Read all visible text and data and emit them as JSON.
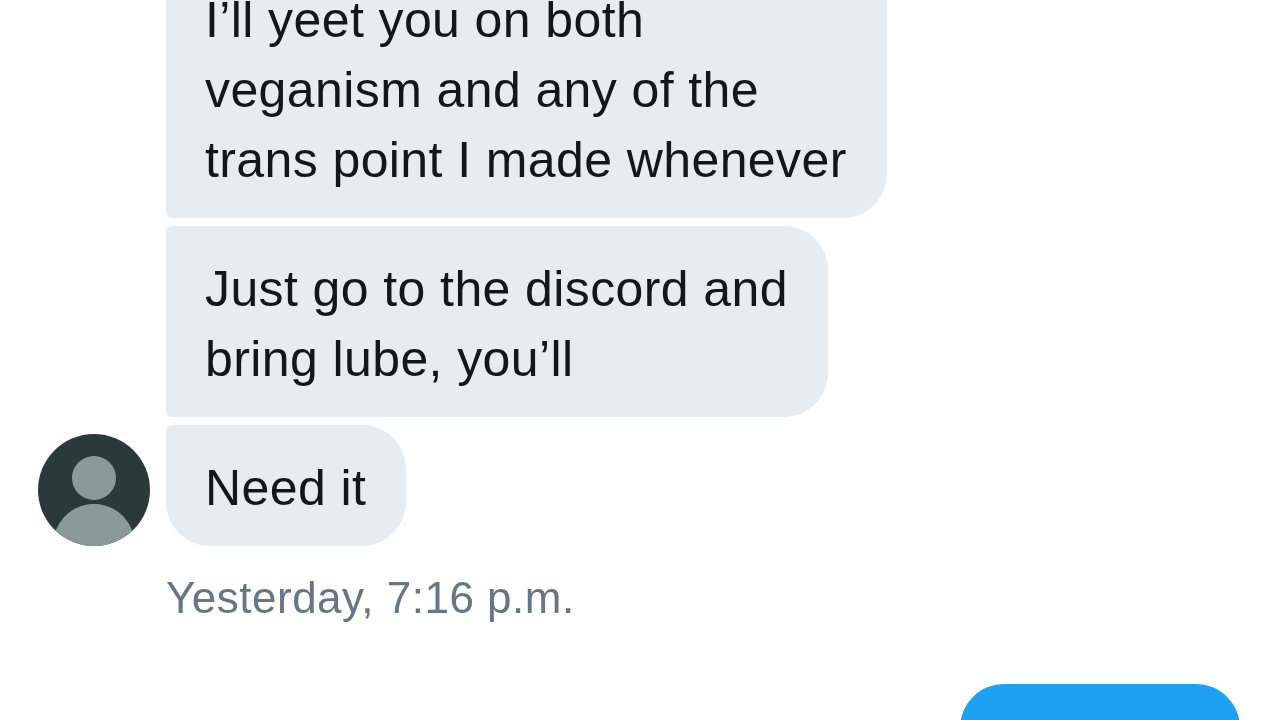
{
  "conversation": {
    "messages": [
      {
        "kind": "incoming",
        "avatar": false,
        "text": "I’ll yeet you on both\nveganism and any of the\ntrans point I made whenever"
      },
      {
        "kind": "incoming",
        "avatar": false,
        "text": "Just go to the discord and\nbring lube, you’ll"
      },
      {
        "kind": "incoming",
        "avatar": true,
        "text": "Need it"
      }
    ],
    "timestamp": "Yesterday, 7:16 p.m.",
    "outgoing": [
      {
        "kind": "outgoing"
      }
    ]
  }
}
